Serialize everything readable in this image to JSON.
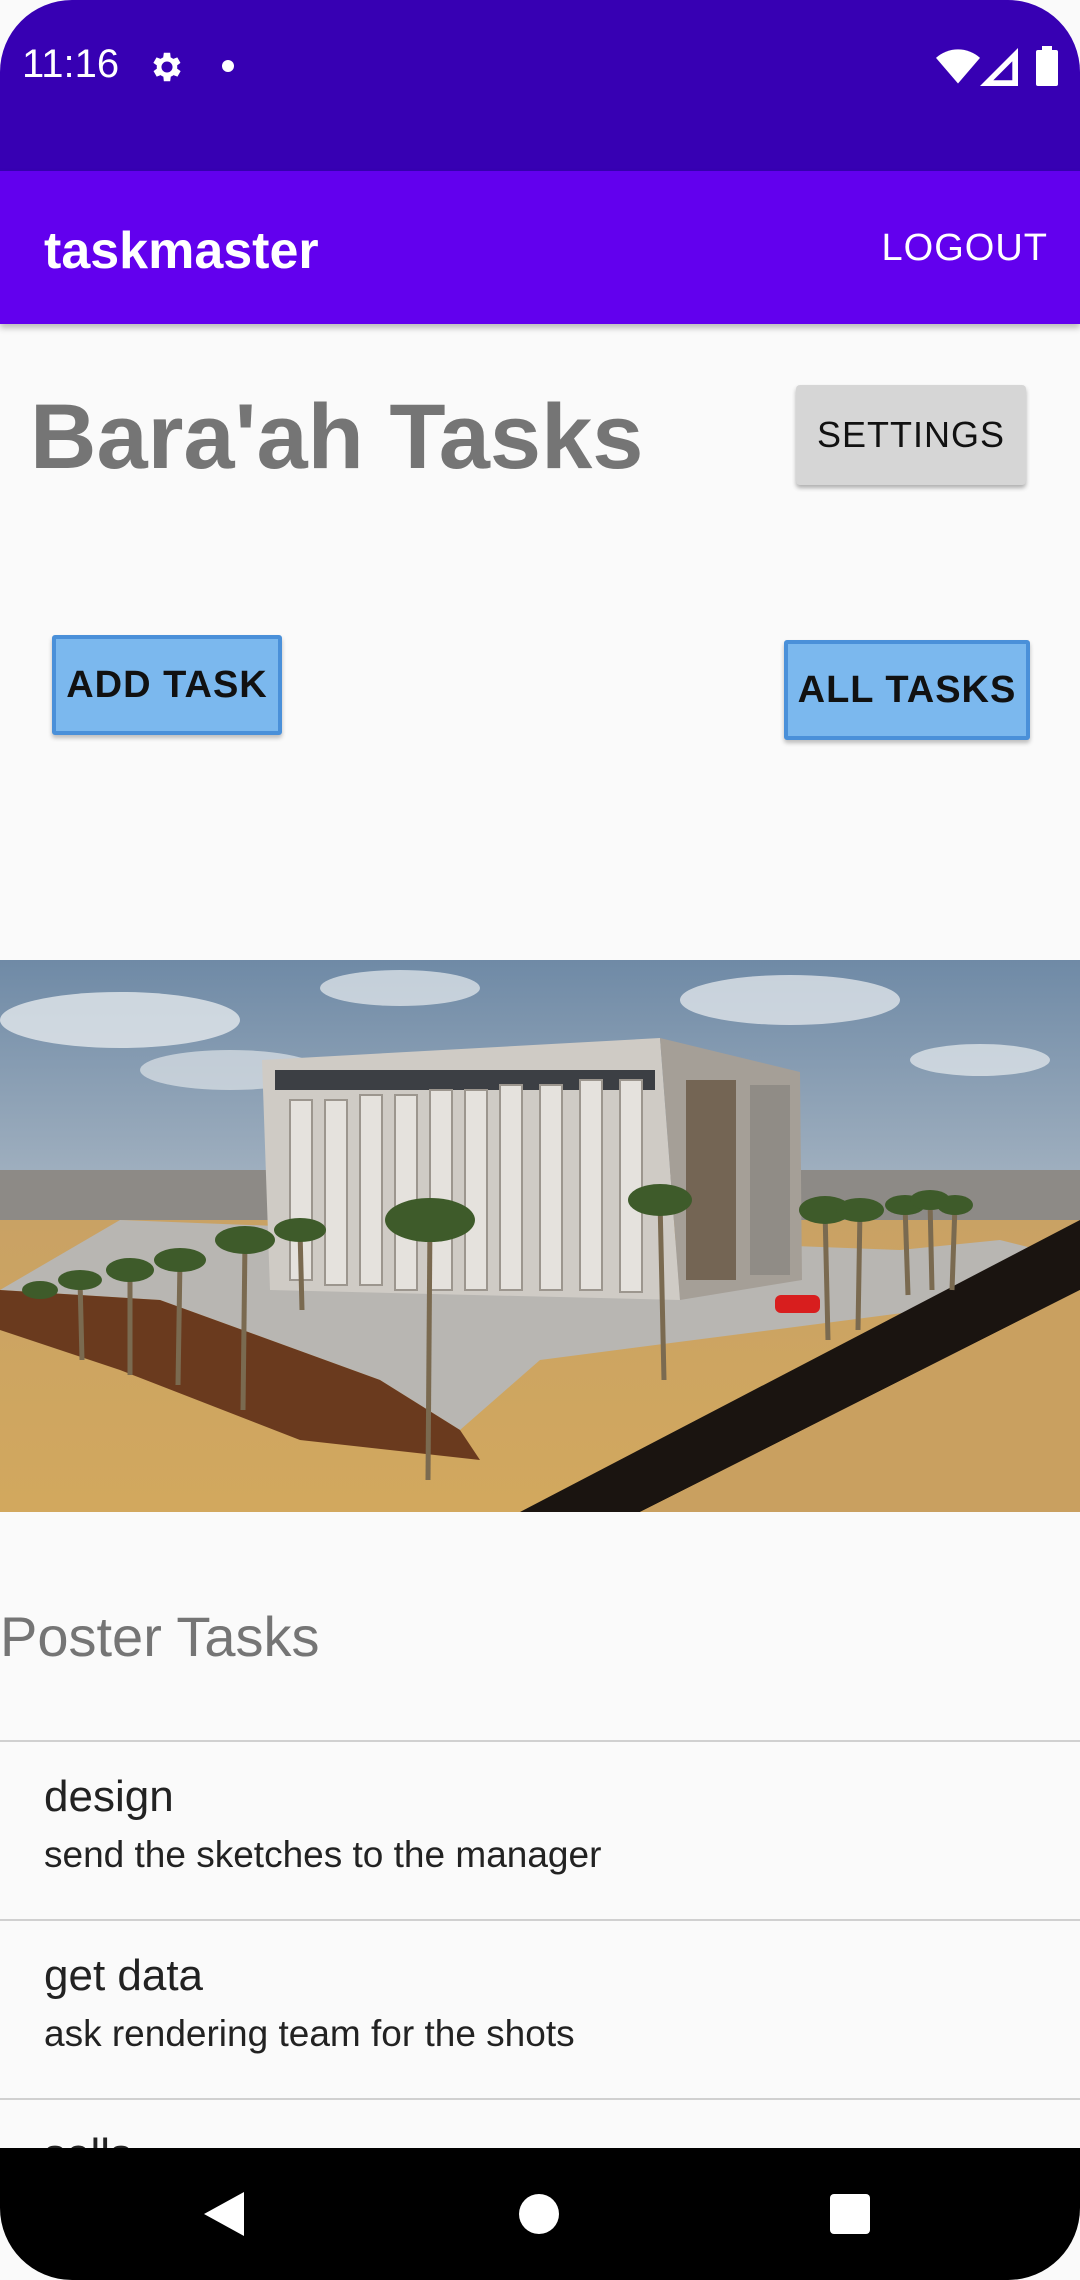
{
  "status_bar": {
    "time": "11:16"
  },
  "app_bar": {
    "title": "taskmaster",
    "logout_label": "LOGOUT"
  },
  "main": {
    "heading": "Bara'ah Tasks",
    "settings_label": "SETTINGS",
    "add_task_label": "ADD TASK",
    "all_tasks_label": "ALL TASKS"
  },
  "section": {
    "title": "Poster Tasks"
  },
  "tasks": [
    {
      "title": "design",
      "description": "send the sketches to the manager"
    },
    {
      "title": "get data",
      "description": "ask rendering team for the shots"
    },
    {
      "title": "sells",
      "description": ""
    }
  ],
  "colors": {
    "status_bar": "#3700B3",
    "app_bar": "#6200EE",
    "button_blue": "#7BB8EE"
  }
}
